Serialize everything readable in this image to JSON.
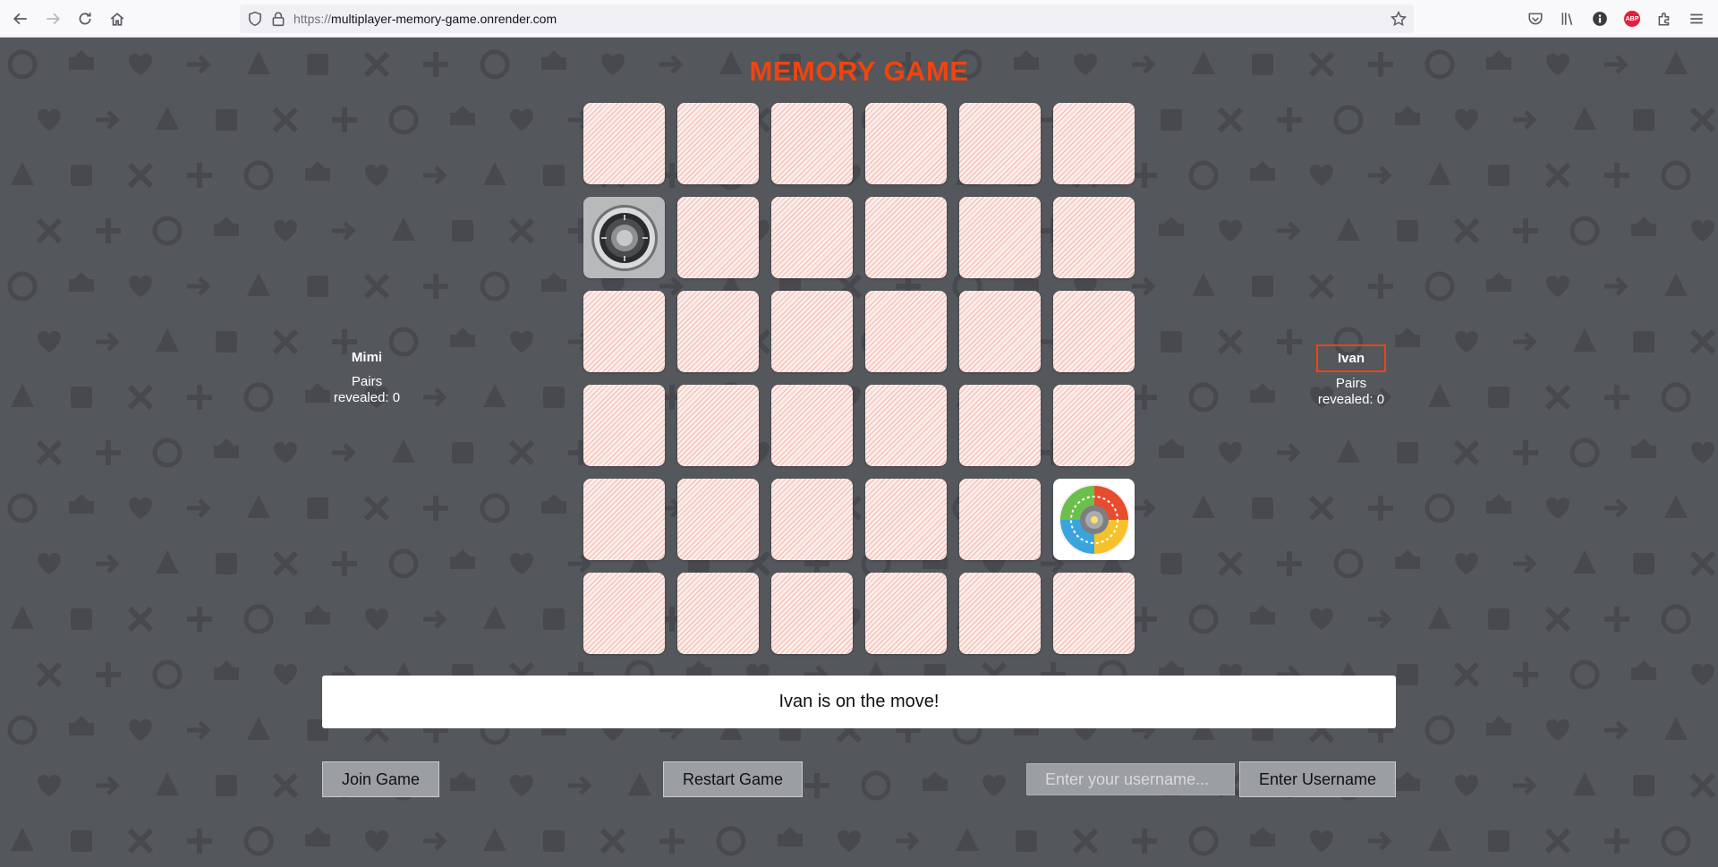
{
  "browser": {
    "url_protocol": "https://",
    "url_host": "multiplayer-memory-game.onrender.com"
  },
  "game": {
    "title": "MEMORY GAME",
    "status_message": "Ivan is on the move!"
  },
  "players": [
    {
      "name": "Mimi",
      "pairs_label": "Pairs revealed: 0",
      "active": false
    },
    {
      "name": "Ivan",
      "pairs_label": "Pairs revealed: 0",
      "active": true
    }
  ],
  "board": {
    "rows": 6,
    "cols": 6,
    "revealed": [
      {
        "row": 1,
        "col": 0,
        "icon": "safe-dial-icon"
      },
      {
        "row": 4,
        "col": 5,
        "icon": "color-wheel-icon"
      }
    ]
  },
  "controls": {
    "join_label": "Join Game",
    "restart_label": "Restart Game",
    "username_placeholder": "Enter your username...",
    "enter_username_label": "Enter Username"
  }
}
